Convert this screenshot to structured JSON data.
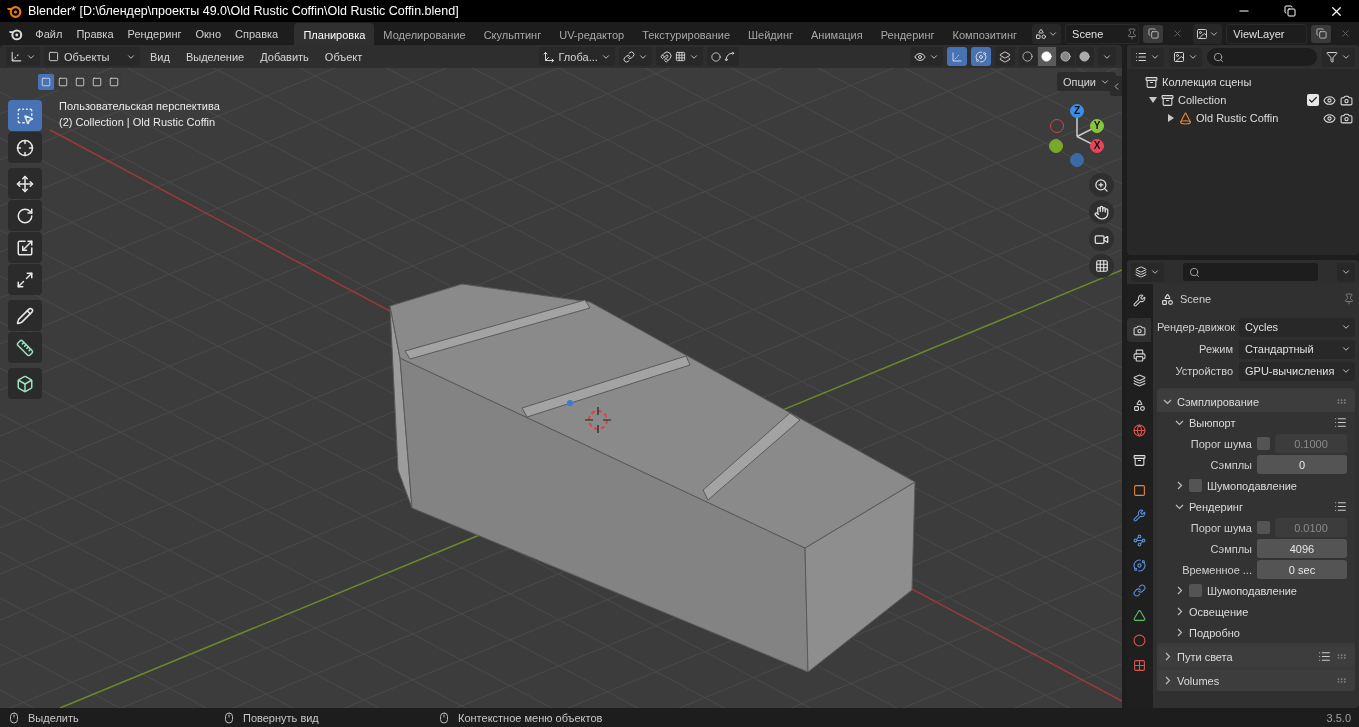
{
  "window": {
    "title": "Blender* [D:\\блендер\\проекты 49.0\\Old Rustic Coffin\\Old Rustic Coffin.blend]"
  },
  "menu": [
    "Файл",
    "Правка",
    "Рендеринг",
    "Окно",
    "Справка"
  ],
  "workspaces": [
    {
      "label": "Планировка",
      "selected": true
    },
    {
      "label": "Моделирование",
      "selected": false
    },
    {
      "label": "Скульптинг",
      "selected": false
    },
    {
      "label": "UV-редактор",
      "selected": false
    },
    {
      "label": "Текстурирование",
      "selected": false
    },
    {
      "label": "Шейдинг",
      "selected": false
    },
    {
      "label": "Анимация",
      "selected": false
    },
    {
      "label": "Рендеринг",
      "selected": false
    },
    {
      "label": "Композитинг",
      "selected": false
    }
  ],
  "scene": "Scene",
  "view_layer": "ViewLayer",
  "viewport": {
    "mode": "Объекты",
    "menus": [
      "Вид",
      "Выделение",
      "Добавить",
      "Объект"
    ],
    "orientation": "Глоба...",
    "options": "Опции",
    "toggles": [
      {
        "kind": "gizmo",
        "on": true
      },
      {
        "kind": "overlay",
        "on": true
      }
    ],
    "shading": [
      {
        "kind": "wire",
        "selected": false
      },
      {
        "kind": "solid",
        "selected": true
      },
      {
        "kind": "material",
        "selected": false
      },
      {
        "kind": "rendered",
        "selected": false
      }
    ],
    "select_modes": [
      {
        "selected": true
      },
      {
        "selected": false
      },
      {
        "selected": false
      },
      {
        "selected": false
      },
      {
        "selected": false
      }
    ],
    "view_name": "Пользовательская перспектива",
    "object_info": "(2) Collection | Old Rustic Coffin",
    "tool_groups": [
      {
        "tools": [
          {
            "kind": "select",
            "selected": true
          },
          {
            "kind": "cursor",
            "selected": false
          }
        ]
      },
      {
        "tools": [
          {
            "kind": "move",
            "selected": false
          },
          {
            "kind": "rotate",
            "selected": false
          },
          {
            "kind": "scale",
            "selected": false
          },
          {
            "kind": "transform",
            "selected": false
          }
        ]
      },
      {
        "tools": [
          {
            "kind": "annotate",
            "selected": false
          },
          {
            "kind": "measure",
            "selected": false
          }
        ]
      },
      {
        "tools": [
          {
            "kind": "add_cube",
            "selected": false
          }
        ]
      }
    ],
    "gizmo": {
      "x": "X",
      "y": "Y",
      "z": "Z"
    }
  },
  "outliner": {
    "root": "Коллекция сцены",
    "children": [
      {
        "label": "Collection",
        "expanded": true,
        "checked": true,
        "children": [
          {
            "label": "Old Rustic Coffin",
            "expanded": false
          }
        ]
      }
    ]
  },
  "properties": {
    "context": "Scene",
    "tab_groups": [
      {
        "tabs": [
          {
            "kind": "tool",
            "selected": false
          }
        ]
      },
      {
        "tabs": [
          {
            "kind": "render",
            "selected": true
          },
          {
            "kind": "output",
            "selected": false
          },
          {
            "kind": "view_layer",
            "selected": false
          },
          {
            "kind": "scene",
            "selected": false
          },
          {
            "kind": "world",
            "selected": false
          }
        ]
      },
      {
        "tabs": [
          {
            "kind": "collection",
            "selected": false
          }
        ]
      },
      {
        "tabs": [
          {
            "kind": "object",
            "selected": false
          },
          {
            "kind": "modifier",
            "selected": false
          },
          {
            "kind": "particles",
            "selected": false
          },
          {
            "kind": "physics",
            "selected": false
          },
          {
            "kind": "constraints",
            "selected": false
          },
          {
            "kind": "data",
            "selected": false
          },
          {
            "kind": "material",
            "selected": false
          },
          {
            "kind": "texture",
            "selected": false
          }
        ]
      }
    ],
    "fields": [
      {
        "label": "Рендер-движок",
        "value": "Cycles"
      },
      {
        "label": "Режим",
        "value": "Стандартный"
      },
      {
        "label": "Устройство",
        "value": "GPU-вычисления"
      }
    ],
    "rows": [
      {
        "kind": "panel",
        "label": "Сэмплирование",
        "expanded": true,
        "presets": false
      },
      {
        "kind": "subpanel",
        "label": "Выюпорт",
        "expanded": true,
        "presets": true
      },
      {
        "kind": "toggle_number",
        "label": "Порог шума",
        "checked": false,
        "value": "0.1000"
      },
      {
        "kind": "number",
        "label": "Сэмплы",
        "value": "0"
      },
      {
        "kind": "check_subpanel",
        "label": "Шумоподавление",
        "expanded": false,
        "checked": false
      },
      {
        "kind": "subpanel",
        "label": "Рендеринг",
        "expanded": true,
        "presets": true
      },
      {
        "kind": "toggle_number",
        "label": "Порог шума",
        "checked": false,
        "value": "0.0100"
      },
      {
        "kind": "number",
        "label": "Сэмплы",
        "value": "4096"
      },
      {
        "kind": "number",
        "label": "Временное ...",
        "value": "0 sec"
      },
      {
        "kind": "check_subpanel",
        "label": "Шумоподавление",
        "expanded": false,
        "checked": false
      },
      {
        "kind": "subpanel",
        "label": "Освещение",
        "expanded": false,
        "presets": false
      },
      {
        "kind": "subpanel",
        "label": "Подробно",
        "expanded": false,
        "presets": false
      },
      {
        "kind": "panel",
        "label": "Пути света",
        "expanded": false,
        "presets": true
      },
      {
        "kind": "panel",
        "label": "Volumes",
        "expanded": false,
        "presets": false
      }
    ]
  },
  "status": [
    "Выделить",
    "Повернуть вид",
    "Контекстное меню объектов"
  ],
  "version": "3.5.0"
}
